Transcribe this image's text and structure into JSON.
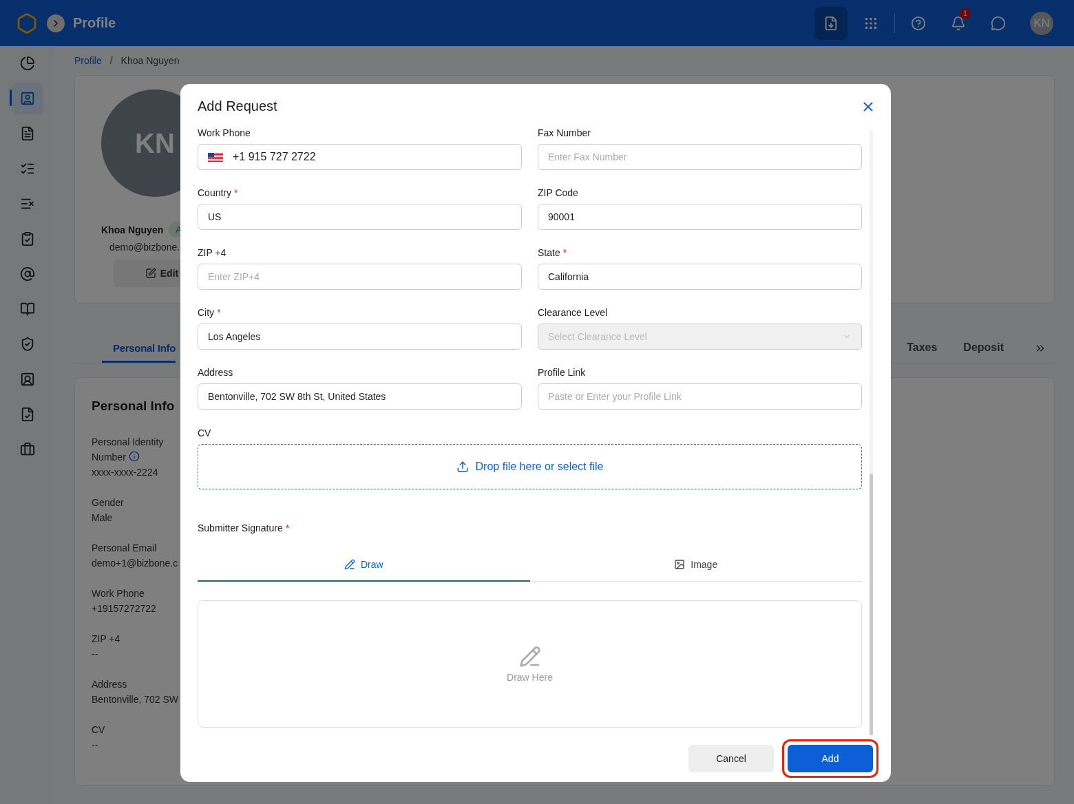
{
  "topbar": {
    "title": "Profile",
    "notifications": "1",
    "avatar": "KN"
  },
  "sidebar": {
    "items": [
      {
        "selected": false
      },
      {
        "selected": true
      },
      {
        "selected": false
      },
      {
        "selected": false
      },
      {
        "selected": false
      },
      {
        "selected": false
      },
      {
        "selected": false
      },
      {
        "selected": false
      },
      {
        "selected": false
      },
      {
        "selected": false
      },
      {
        "selected": false
      },
      {
        "selected": false
      }
    ]
  },
  "breadcrumb": {
    "items": [
      "Profile",
      "Khoa Nguyen"
    ],
    "separator": "/"
  },
  "profile": {
    "avatar": "KN",
    "name": "Khoa Nguyen",
    "badge": "A",
    "email": "demo@bizbone.",
    "edit": "Edit"
  },
  "profile_tabs": [
    {
      "label": "Personal Info",
      "selected": true
    },
    {
      "label": "Taxes",
      "selected": false
    },
    {
      "label": "Deposit",
      "selected": false
    }
  ],
  "personal_info": {
    "title": "Personal Info",
    "fields": [
      {
        "label": "Personal Identity Number",
        "value": "xxxx-xxxx-2224",
        "info": true
      },
      {
        "label": "Gender",
        "value": "Male"
      },
      {
        "label": "Personal Email",
        "value": "demo+1@bizbone.c"
      },
      {
        "label": "Work Phone",
        "value": "+19157272722"
      },
      {
        "label": "ZIP +4",
        "value": "--"
      },
      {
        "label": "Address",
        "value": "Bentonville, 702 SW"
      },
      {
        "label": "CV",
        "value": "--"
      }
    ]
  },
  "dialog": {
    "title": "Add Request",
    "fields": [
      {
        "kind": "phone",
        "label": "Work Phone",
        "value": "+1 915 727 2722"
      },
      {
        "kind": "text",
        "label": "Fax Number",
        "placeholder": "Enter Fax Number"
      },
      {
        "kind": "text",
        "label": "Country",
        "required_mark": "*",
        "value": "US"
      },
      {
        "kind": "text",
        "label": "ZIP Code",
        "value": "90001"
      },
      {
        "kind": "text",
        "label": "ZIP +4",
        "placeholder": "Enter ZIP+4"
      },
      {
        "kind": "text",
        "label": "State",
        "required_mark": "*",
        "value": "California"
      },
      {
        "kind": "text",
        "label": "City",
        "required_mark": "*",
        "value": "Los Angeles"
      },
      {
        "kind": "select",
        "label": "Clearance Level",
        "placeholder": "Select Clearance Level",
        "disabled": true
      },
      {
        "kind": "text",
        "label": "Address",
        "value": "Bentonville, 702 SW 8th St, United States"
      },
      {
        "kind": "text",
        "label": "Profile Link",
        "placeholder": "Paste or Enter your Profile Link"
      }
    ],
    "cv": {
      "label": "CV",
      "drop": "Drop file here or select file"
    },
    "signature": {
      "label": "Submitter Signature",
      "required_mark": "*",
      "tabs": [
        {
          "label": "Draw",
          "selected": true
        },
        {
          "label": "Image",
          "selected": false
        }
      ],
      "hint": "Draw Here"
    },
    "buttons": {
      "cancel": "Cancel",
      "add": "Add"
    }
  }
}
